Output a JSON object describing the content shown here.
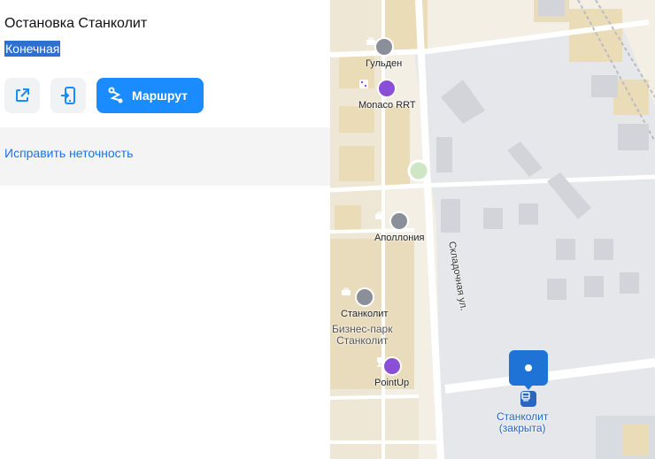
{
  "panel": {
    "title": "Остановка Станколит",
    "subtitle": "Конечная",
    "share_icon": "share-icon",
    "phone_icon": "send-to-phone-icon",
    "route_label": "Маршрут",
    "route_icon": "route-icon",
    "fix_link": "Исправить неточность"
  },
  "map": {
    "pois": [
      {
        "label": "Гульден",
        "icon": "briefcase-icon"
      },
      {
        "label": "Monaco RRT",
        "icon": "dice-icon"
      },
      {
        "label": "Аполлония",
        "icon": "briefcase-icon"
      },
      {
        "label": "Станколит",
        "icon": "briefcase-icon"
      },
      {
        "label": "Бизнес-парк\nСтанколит",
        "icon": ""
      },
      {
        "label": "PointUp",
        "icon": "trophy-icon"
      }
    ],
    "street": "Складочная ул.",
    "stop_label_line1": "Станколит",
    "stop_label_line2": "(закрыта)"
  },
  "colors": {
    "accent": "#1a8cff",
    "selection": "#2d6fd3",
    "link": "#1a73e8",
    "marker": "#1f73d6",
    "map_bg": "#f3efe5",
    "poi_gray": "#8a8f99",
    "poi_purple": "#8a4fd6"
  }
}
